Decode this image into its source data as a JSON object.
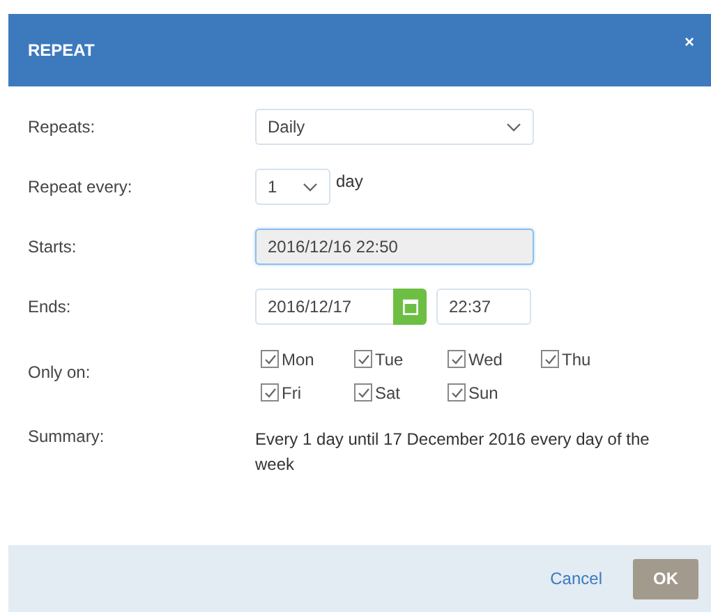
{
  "dialog": {
    "title": "REPEAT",
    "close": "×"
  },
  "repeats": {
    "label": "Repeats:",
    "value": "Daily"
  },
  "repeat_every": {
    "label": "Repeat every:",
    "value": "1",
    "unit": "day"
  },
  "starts": {
    "label": "Starts:",
    "value": "2016/12/16 22:50"
  },
  "ends": {
    "label": "Ends:",
    "date": "2016/12/17",
    "time": "22:37"
  },
  "only_on": {
    "label": "Only on:",
    "days": [
      {
        "label": "Mon",
        "checked": true
      },
      {
        "label": "Tue",
        "checked": true
      },
      {
        "label": "Wed",
        "checked": true
      },
      {
        "label": "Thu",
        "checked": true
      },
      {
        "label": "Fri",
        "checked": true
      },
      {
        "label": "Sat",
        "checked": true
      },
      {
        "label": "Sun",
        "checked": true
      }
    ]
  },
  "summary": {
    "label": "Summary:",
    "text": "Every 1 day until 17 December 2016 every day of the week"
  },
  "buttons": {
    "cancel": "Cancel",
    "ok": "OK"
  }
}
